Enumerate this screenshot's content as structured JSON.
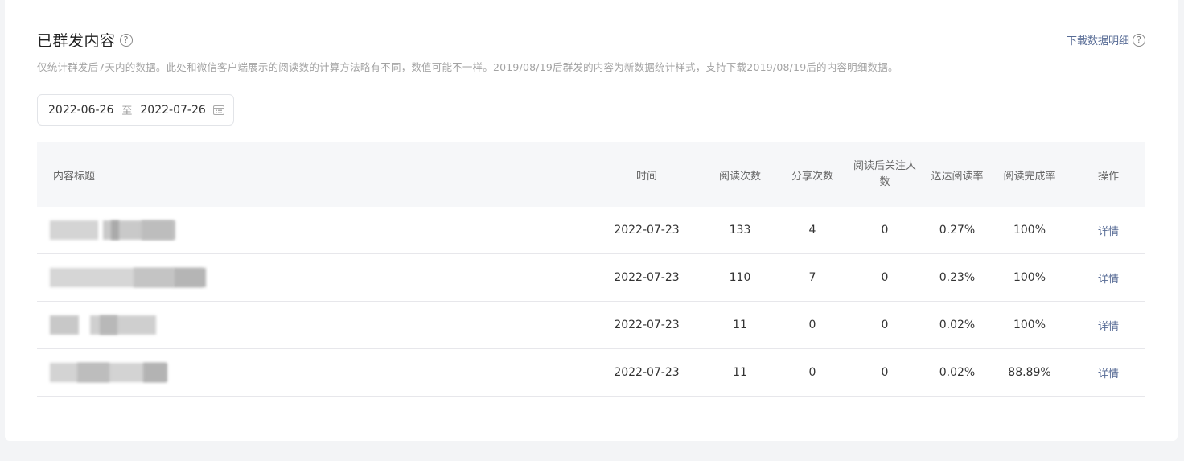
{
  "header": {
    "title": "已群发内容",
    "help_glyph": "?",
    "download_label": "下载数据明细",
    "description": "仅统计群发后7天内的数据。此处和微信客户端展示的阅读数的计算方法略有不同，数值可能不一样。2019/08/19后群发的内容为新数据统计样式，支持下载2019/08/19后的内容明细数据。"
  },
  "date_range": {
    "start": "2022-06-26",
    "separator": "至",
    "end": "2022-07-26"
  },
  "table": {
    "columns": {
      "title": "内容标题",
      "time": "时间",
      "reads": "阅读次数",
      "shares": "分享次数",
      "follows": "阅读后关注人数",
      "delivery_rate": "送达阅读率",
      "completion_rate": "阅读完成率",
      "action": "操作"
    },
    "rows": [
      {
        "time": "2022-07-23",
        "reads": "133",
        "shares": "4",
        "follows": "0",
        "delivery_rate": "0.27%",
        "completion_rate": "100%",
        "action": "详情"
      },
      {
        "time": "2022-07-23",
        "reads": "110",
        "shares": "7",
        "follows": "0",
        "delivery_rate": "0.23%",
        "completion_rate": "100%",
        "action": "详情"
      },
      {
        "time": "2022-07-23",
        "reads": "11",
        "shares": "0",
        "follows": "0",
        "delivery_rate": "0.02%",
        "completion_rate": "100%",
        "action": "详情"
      },
      {
        "time": "2022-07-23",
        "reads": "11",
        "shares": "0",
        "follows": "0",
        "delivery_rate": "0.02%",
        "completion_rate": "88.89%",
        "action": "详情"
      }
    ]
  },
  "colors": {
    "link": "#576b95",
    "header_bg": "#f6f7f9",
    "page_bg": "#f3f4f6"
  }
}
